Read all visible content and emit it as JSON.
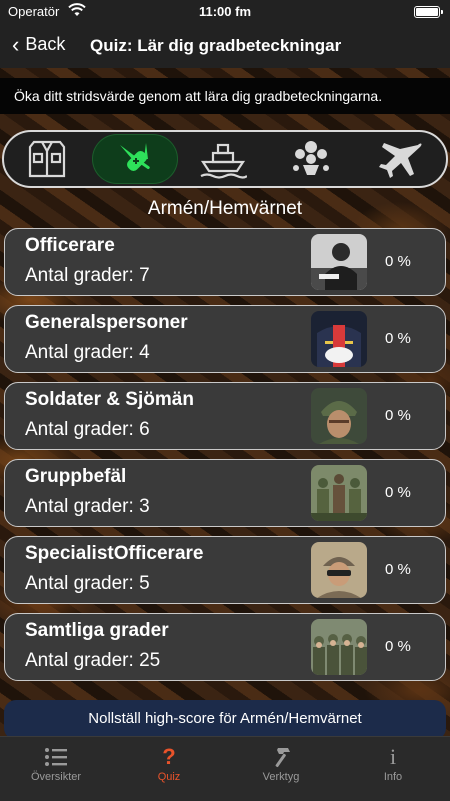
{
  "status": {
    "carrier": "Operatör",
    "time": "11:00 fm"
  },
  "nav": {
    "back_label": "Back",
    "title": "Quiz: Lär dig gradbeteckningar"
  },
  "banner": "Öka ditt stridsvärde genom att lära dig gradbeteckningarna.",
  "categories": [
    {
      "icon": "uniform-icon"
    },
    {
      "icon": "swiss-army-knife-icon",
      "active": true
    },
    {
      "icon": "ship-icon"
    },
    {
      "icon": "insignia-emblem-icon"
    },
    {
      "icon": "airplane-icon"
    }
  ],
  "section_title": "Armén/Hemvärnet",
  "rows": [
    {
      "name": "Officerare",
      "count": "Antal grader: 7",
      "pct": "0 %"
    },
    {
      "name": "Generalspersoner",
      "count": "Antal grader: 4",
      "pct": "0 %"
    },
    {
      "name": "Soldater & Sjömän",
      "count": "Antal grader: 6",
      "pct": "0 %"
    },
    {
      "name": "Gruppbefäl",
      "count": "Antal grader: 3",
      "pct": "0 %"
    },
    {
      "name": "SpecialistOfficerare",
      "count": "Antal grader: 5",
      "pct": "0 %"
    },
    {
      "name": "Samtliga grader",
      "count": "Antal grader: 25",
      "pct": "0 %"
    }
  ],
  "reset_label": "Nollställ high-score för Armén/Hemvärnet",
  "tabs": [
    {
      "label": "Översikter",
      "icon": "list-icon"
    },
    {
      "label": "Quiz",
      "icon": "question-icon",
      "active": true
    },
    {
      "label": "Verktyg",
      "icon": "hammer-icon"
    },
    {
      "label": "Info",
      "icon": "info-icon"
    }
  ],
  "colors": {
    "accent": "#e8532a",
    "active_category": "#0e3d1b",
    "row_bg": "#3a3a3a",
    "reset_bg": "#1c2b4a"
  }
}
